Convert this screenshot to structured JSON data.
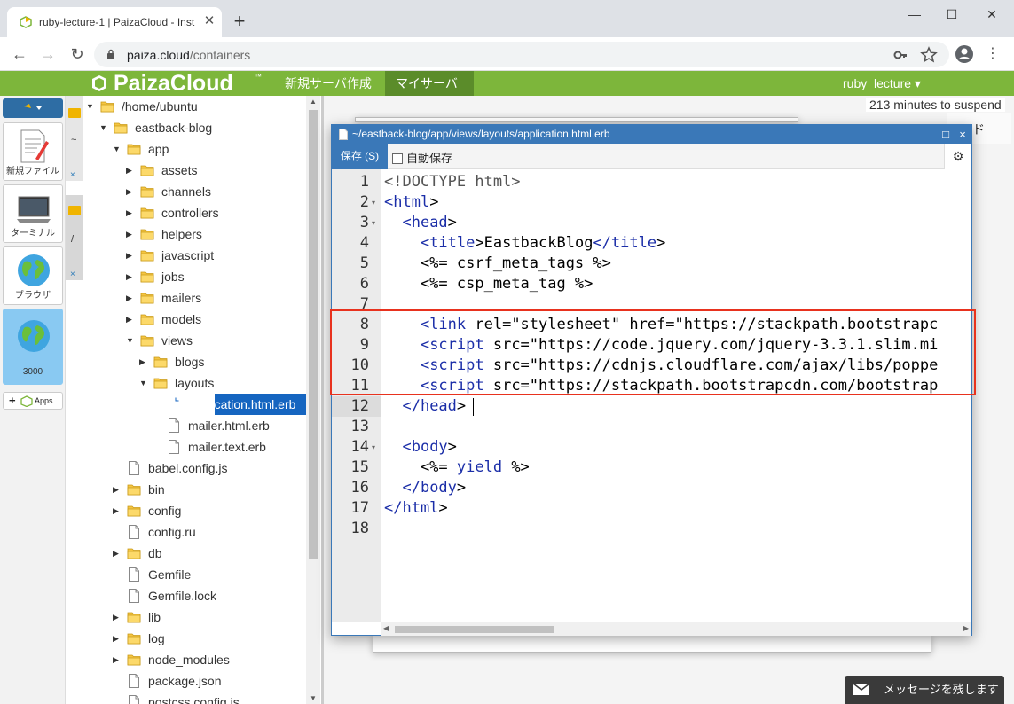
{
  "browser": {
    "tab_title": "ruby-lecture-1 | PaizaCloud - Inst",
    "tab_close": "✕",
    "new_tab": "+",
    "window_controls": {
      "minimize": "—",
      "maximize": "☐",
      "close": "✕"
    },
    "url_host": "paiza.cloud",
    "url_path": "/containers",
    "nav": {
      "back": "←",
      "forward": "→",
      "reload": "↻"
    },
    "menu": "⋮"
  },
  "header": {
    "logo": "PaizaCloud",
    "logo_tm": "™",
    "nav": [
      {
        "label": "新規サーバ作成"
      },
      {
        "label": "マイサーバ"
      }
    ],
    "user": "ruby_lecture ▾",
    "brand_color": "#7db63b"
  },
  "dock": {
    "items": [
      {
        "label": "新規ファイル",
        "icon": "new-file-icon"
      },
      {
        "label": "ターミナル",
        "icon": "terminal-icon"
      },
      {
        "label": "ブラウザ",
        "icon": "globe-icon"
      },
      {
        "label": "3000",
        "icon": "globe-icon"
      }
    ],
    "apps_label": "Apps"
  },
  "winstrip": {
    "close": "×",
    "tilde1": "~",
    "tilde2": "/"
  },
  "filetree": {
    "rows": [
      {
        "label": "/home/ubuntu",
        "type": "folder",
        "arrow": "▼"
      },
      {
        "label": "eastback-blog",
        "type": "folder",
        "arrow": "▼"
      },
      {
        "label": "app",
        "type": "folder",
        "arrow": "▼"
      },
      {
        "label": "assets",
        "type": "folder",
        "arrow": "▶"
      },
      {
        "label": "channels",
        "type": "folder",
        "arrow": "▶"
      },
      {
        "label": "controllers",
        "type": "folder",
        "arrow": "▶"
      },
      {
        "label": "helpers",
        "type": "folder",
        "arrow": "▶"
      },
      {
        "label": "javascript",
        "type": "folder",
        "arrow": "▶"
      },
      {
        "label": "jobs",
        "type": "folder",
        "arrow": "▶"
      },
      {
        "label": "mailers",
        "type": "folder",
        "arrow": "▶"
      },
      {
        "label": "models",
        "type": "folder",
        "arrow": "▶"
      },
      {
        "label": "views",
        "type": "folder",
        "arrow": "▼"
      },
      {
        "label": "blogs",
        "type": "folder",
        "arrow": "▶"
      },
      {
        "label": "layouts",
        "type": "folder",
        "arrow": "▼"
      },
      {
        "label": "application.html.erb",
        "type": "file",
        "arrow": ""
      },
      {
        "label": "mailer.html.erb",
        "type": "file",
        "arrow": ""
      },
      {
        "label": "mailer.text.erb",
        "type": "file",
        "arrow": ""
      },
      {
        "label": "babel.config.js",
        "type": "file",
        "arrow": ""
      },
      {
        "label": "bin",
        "type": "folder",
        "arrow": "▶"
      },
      {
        "label": "config",
        "type": "folder",
        "arrow": "▶"
      },
      {
        "label": "config.ru",
        "type": "file",
        "arrow": ""
      },
      {
        "label": "db",
        "type": "folder",
        "arrow": "▶"
      },
      {
        "label": "Gemfile",
        "type": "file",
        "arrow": ""
      },
      {
        "label": "Gemfile.lock",
        "type": "file",
        "arrow": ""
      },
      {
        "label": "lib",
        "type": "folder",
        "arrow": "▶"
      },
      {
        "label": "log",
        "type": "folder",
        "arrow": "▶"
      },
      {
        "label": "node_modules",
        "type": "folder",
        "arrow": "▶"
      },
      {
        "label": "package.json",
        "type": "file",
        "arrow": ""
      },
      {
        "label": "postcss.config.js",
        "type": "file",
        "arrow": ""
      }
    ]
  },
  "workspace": {
    "suspend_text": "213 minutes to suspend",
    "bg_fragment": "ド"
  },
  "editor": {
    "path": "~/eastback-blog/app/views/layouts/application.html.erb",
    "maximize": "□",
    "close": "×",
    "save_label": "保存 (S)",
    "autosave_label": "自動保存",
    "gear": "⚙",
    "lines": [
      {
        "n": "1",
        "fold": ""
      },
      {
        "n": "2",
        "fold": "▾"
      },
      {
        "n": "3",
        "fold": "▾"
      },
      {
        "n": "4",
        "fold": ""
      },
      {
        "n": "5",
        "fold": ""
      },
      {
        "n": "6",
        "fold": ""
      },
      {
        "n": "7",
        "fold": ""
      },
      {
        "n": "8",
        "fold": ""
      },
      {
        "n": "9",
        "fold": ""
      },
      {
        "n": "10",
        "fold": ""
      },
      {
        "n": "11",
        "fold": ""
      },
      {
        "n": "12",
        "fold": ""
      },
      {
        "n": "13",
        "fold": ""
      },
      {
        "n": "14",
        "fold": "▾"
      },
      {
        "n": "15",
        "fold": ""
      },
      {
        "n": "16",
        "fold": ""
      },
      {
        "n": "17",
        "fold": ""
      },
      {
        "n": "18",
        "fold": ""
      }
    ],
    "code": [
      "<!DOCTYPE html>",
      "<html>",
      "  <head>",
      "    <title>EastbackBlog</title>",
      "    <%= csrf_meta_tags %>",
      "    <%= csp_meta_tag %>",
      "",
      "    <link rel=\"stylesheet\" href=\"https://stackpath.bootstrapc",
      "    <script src=\"https://code.jquery.com/jquery-3.3.1.slim.mi",
      "    <script src=\"https://cdnjs.cloudflare.com/ajax/libs/poppe",
      "    <script src=\"https://stackpath.bootstrapcdn.com/bootstrap",
      "  </head>",
      "",
      "  <body>",
      "    <%= yield %>",
      "  </body>",
      "</html>",
      ""
    ],
    "active_line": "12"
  },
  "message_button": "メッセージを残します",
  "colors": {
    "accent": "#3a78b8",
    "highlight_border": "#e8321e",
    "selection": "#1565c0"
  }
}
